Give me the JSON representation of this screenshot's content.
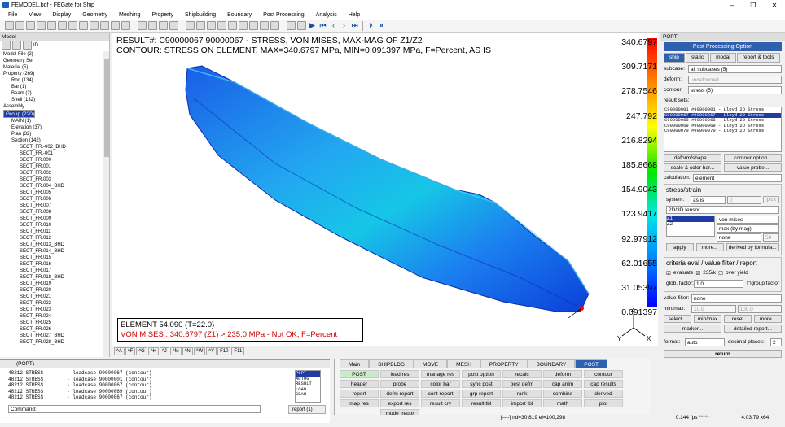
{
  "window": {
    "title": "FEMODEL.bdf - FEGate for Ship"
  },
  "menu": [
    "File",
    "View",
    "Display",
    "Geometry",
    "Meshing",
    "Property",
    "Shipbuilding",
    "Boundary",
    "Post Processing",
    "Analysis",
    "Help"
  ],
  "left_panel": {
    "title": "Model",
    "tree": [
      "Model File (2)",
      "Geometry Set",
      "Material (5)",
      "Property (269)",
      "Rod (134)",
      "Bar (1)",
      "Beam (2)",
      "Shell (132)",
      "Assembly",
      "Group (220)",
      "MAIN (1)",
      "Elevation (37)",
      "Plan (32)",
      "Section (142)",
      "SECT_FR.-002_BHD",
      "SECT_FR.-001",
      "SECT_FR.000",
      "SECT_FR.001",
      "SECT_FR.002",
      "SECT_FR.003",
      "SECT_FR.004_BHD",
      "SECT_FR.005",
      "SECT_FR.006",
      "SECT_FR.007",
      "SECT_FR.008",
      "SECT_FR.009",
      "SECT_FR.010",
      "SECT_FR.011",
      "SECT_FR.012",
      "SECT_FR.013_BHD",
      "SECT_FR.014_BHD",
      "SECT_FR.015",
      "SECT_FR.016",
      "SECT_FR.017",
      "SECT_FR.018_BHD",
      "SECT_FR.019",
      "SECT_FR.020",
      "SECT_FR.021",
      "SECT_FR.022",
      "SECT_FR.023",
      "SECT_FR.024",
      "SECT_FR.025",
      "SECT_FR.026",
      "SECT_FR.027_BHD",
      "SECT_FR.028_BHD"
    ]
  },
  "viewport": {
    "title1": "RESULT#: C90000067 90000067 - STRESS, VON MISES, MAX-MAG OF Z1/Z2",
    "title2": "CONTOUR: STRESS ON ELEMENT, MAX=340.6797 MPa, MIN=0.091397 MPa, F=Percent, AS IS",
    "legend": [
      "340.6797",
      "309.7171",
      "278.7546",
      "247.792",
      "216.8294",
      "185.8668",
      "154.9043",
      "123.9417",
      "92.97912",
      "62.01655",
      "31.05397",
      "0.091397"
    ],
    "info_line1": "ELEMENT 54,090 (T=22.0)",
    "info_line2": "VON MISES : 340.6797 (Z1) > 235.0 MPa - Not OK, F=Percent",
    "fkeys": [
      "^A",
      "^F",
      "^G",
      "^H",
      "^J",
      "^M",
      "^N",
      "^W",
      "^Y",
      "F10",
      "F11"
    ],
    "axis_z": "Z",
    "axis_x": "X",
    "axis_y": "Y"
  },
  "command": {
    "header": "(POPT)",
    "log": "48212 STRESS        - loadcase 90000067 (contour)\n48212 STRESS        - loadcase 90000001 (contour)\n48212 STRESS        - loadcase 90000067 (contour)\n48212 STRESS        - loadcase 90000069 (contour)\n48212 STRESS        - loadcase 90000067 (contour)",
    "list": [
      "POPT",
      "AUTOG",
      "RESULT",
      "LOAD",
      "CBAR"
    ],
    "label": "Command:",
    "report": "report (1)"
  },
  "user_menu": {
    "tabs": [
      "Main",
      "SHIPBLDG",
      "MOVE",
      "MESH",
      "PROPERTY",
      "BOUNDARY",
      "POST"
    ],
    "buttons": [
      "POST",
      "load res",
      "manage res",
      "post option",
      "recalc",
      "deform",
      "contour",
      "header",
      "probe",
      "color bar",
      "sync post",
      "best defm",
      "cap anim",
      "cap results",
      "report",
      "defm report",
      "cont report",
      "grp report",
      "rank",
      "combine",
      "derived",
      "map res",
      "export res",
      "result crv",
      "result tbl",
      "import tbl",
      "math",
      "plot",
      "",
      "mode_repor",
      "",
      "",
      "",
      "",
      "",
      ""
    ]
  },
  "right_panel": {
    "header": "POPT",
    "title": "Post Processing Option",
    "tabs": [
      "ship",
      "static",
      "modal",
      "report & tools"
    ],
    "subcase_label": "subcase:",
    "subcase": "all subcases (5)",
    "deform_label": "deform:",
    "deform": "undeformed",
    "contour_label": "contour:",
    "contour": "stress (5)",
    "result_sets_label": "result sets:",
    "result_sets": [
      "C90000001 #90000001 - Lloyd 2D Stress",
      "C90000067 #90000067 - Lloyd 2D Stress",
      "C90000068 #90000068 - Lloyd 2D Stress",
      "C90000069 #90000069 - Lloyd 2D Stress",
      "C90000070 #90000070 - Lloyd 2D Stress"
    ],
    "btn_deform": "deform/shape...",
    "btn_contour": "contour option...",
    "btn_scale": "scale & color bar...",
    "btn_probe": "value probe...",
    "calc_label": "calculation:",
    "calc": "element",
    "ss_title": "stress/strain",
    "system_label": "system:",
    "system": "as is",
    "system_val": "0",
    "pick": "pick",
    "tensor": "2D/3D tensor",
    "zlist": [
      "Z1",
      "Z2"
    ],
    "vm": "von mises",
    "maxmag": "max (by mag)",
    "none": "none",
    "pct": "50",
    "apply": "apply",
    "more": "more...",
    "derived": "derived by formula...",
    "crit_title": "criteria eval / value filter / report",
    "evaluate": "evaluate",
    "k235": "235/k",
    "over_yield": "over yield",
    "glob_label": "glob. factor:",
    "glob": "1.0",
    "group_factor": "group factor",
    "vfilter_label": "value filter:",
    "vfilter": "none",
    "minmax_label": "min/max:",
    "vmin": "10.0",
    "vmax": "100.0",
    "btn_select": "select...",
    "btn_minmax": "min/max",
    "btn_reset": "reset",
    "btn_more": "more...",
    "btn_marker": "marker...",
    "btn_detailed": "detailed report...",
    "format_label": "format:",
    "format": "auto",
    "dec_label": "decimal places:",
    "dec": "2",
    "return": "return"
  },
  "status": {
    "center": "[----]  nd=30,819  el=100,298",
    "fps": "0.144 fps *****",
    "mem": "4.03.79  x64"
  }
}
